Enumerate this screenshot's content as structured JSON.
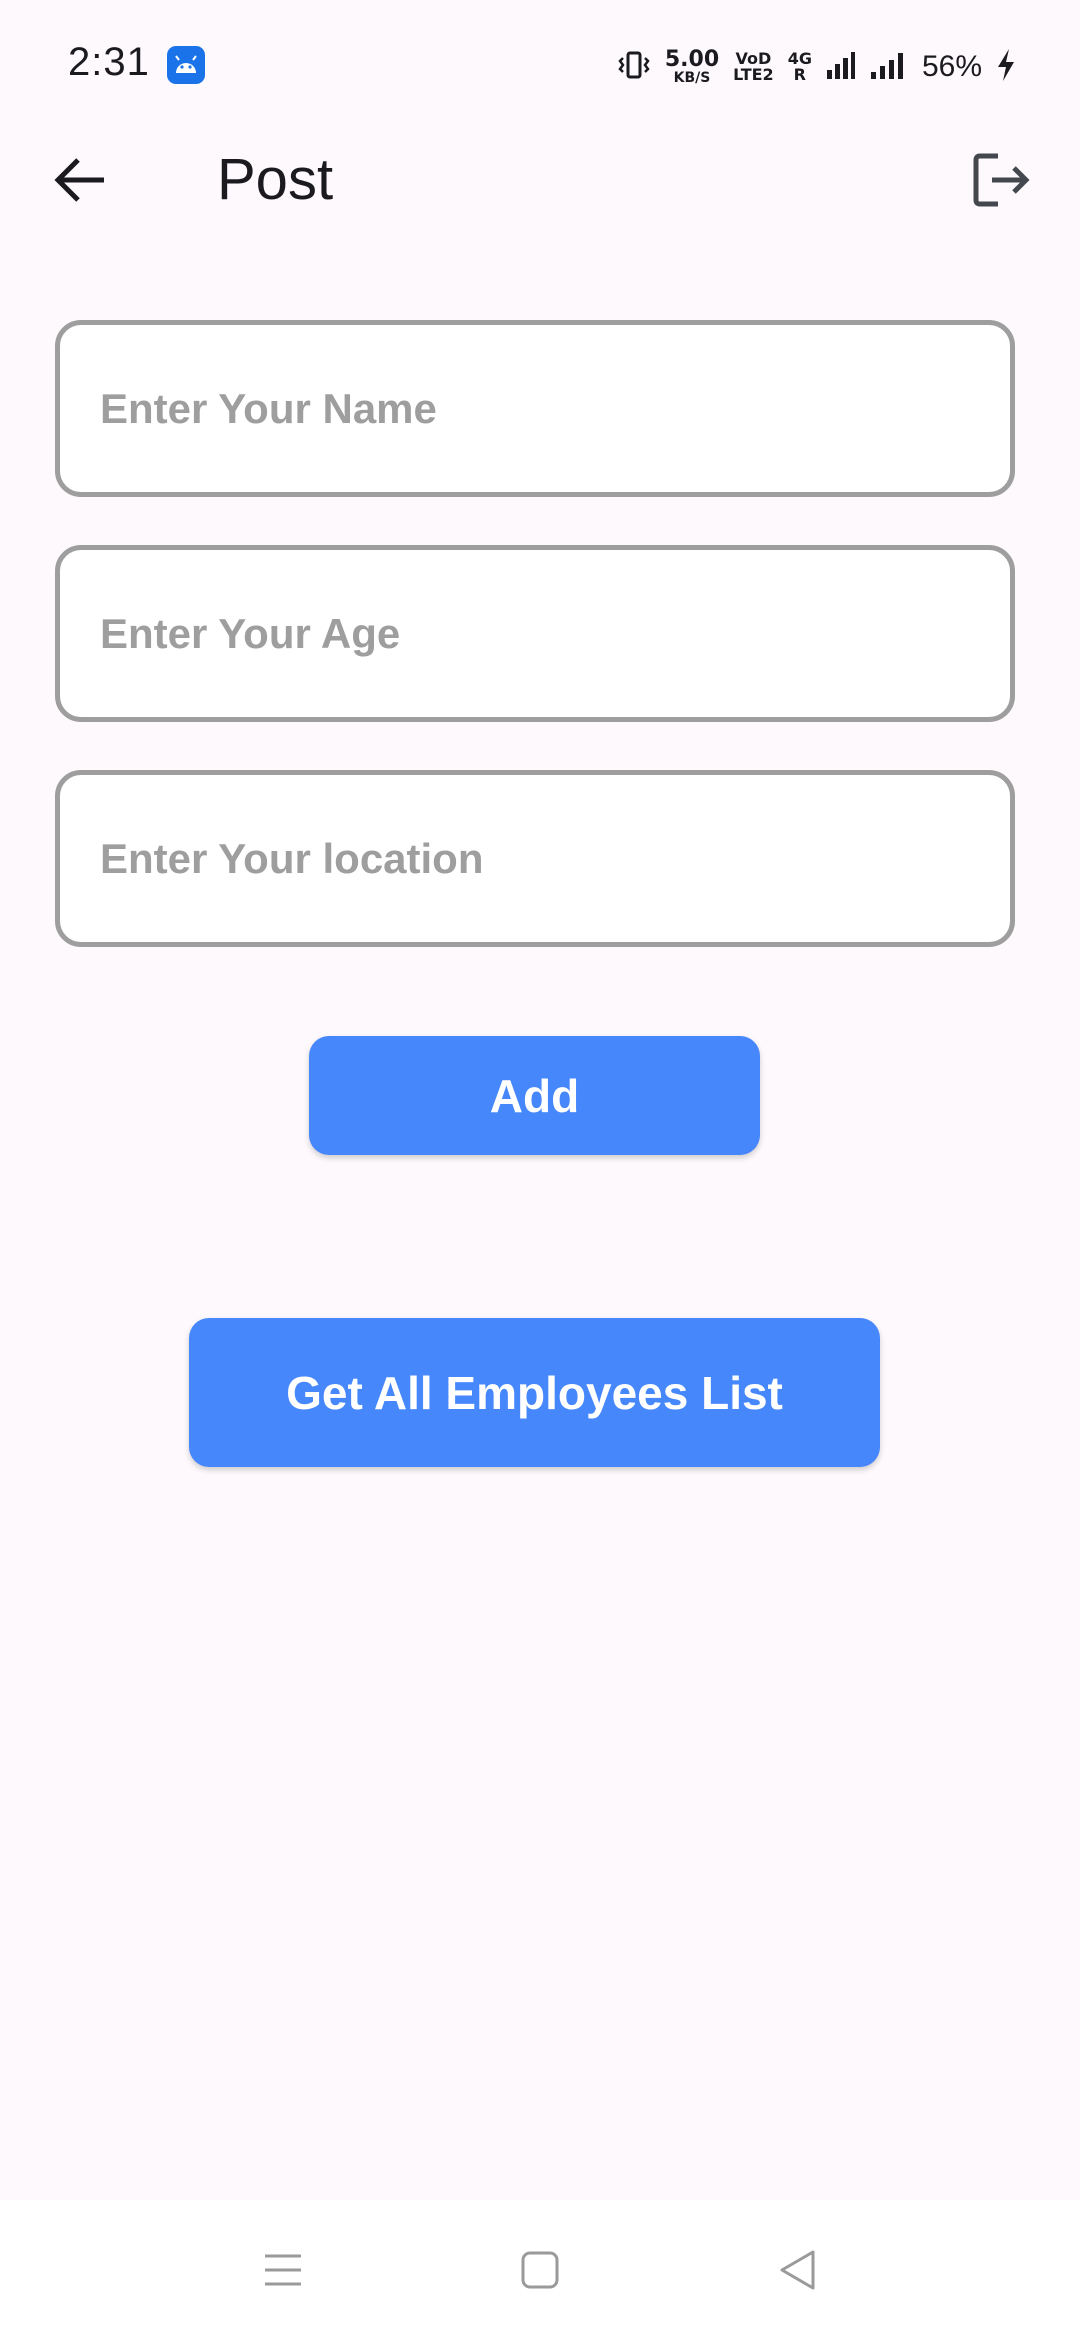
{
  "status_bar": {
    "time": "2:31",
    "net_speed_value": "5.00",
    "net_speed_unit": "KB/S",
    "volte_top": "VoD",
    "volte_bottom": "LTE2",
    "network_top": "4G",
    "network_bottom": "R",
    "battery": "56%",
    "icons": [
      "android-app-icon",
      "vibrate-icon",
      "signal-icon",
      "signal-icon",
      "charging-icon"
    ]
  },
  "app_bar": {
    "title": "Post",
    "back_icon": "arrow-left-icon",
    "logout_icon": "logout-icon"
  },
  "form": {
    "name_placeholder": "Enter Your Name",
    "name_value": "",
    "age_placeholder": "Enter Your Age",
    "age_value": "",
    "location_placeholder": "Enter Your location",
    "location_value": ""
  },
  "buttons": {
    "add_label": "Add",
    "list_label": "Get All Employees List"
  },
  "nav_bar": {
    "icons": [
      "menu-icon",
      "home-icon",
      "back-triangle-icon"
    ]
  },
  "colors": {
    "background": "#fdf9fc",
    "accent": "#4687fb",
    "field_border": "#9e9e9e",
    "placeholder": "#9e9e9e"
  }
}
